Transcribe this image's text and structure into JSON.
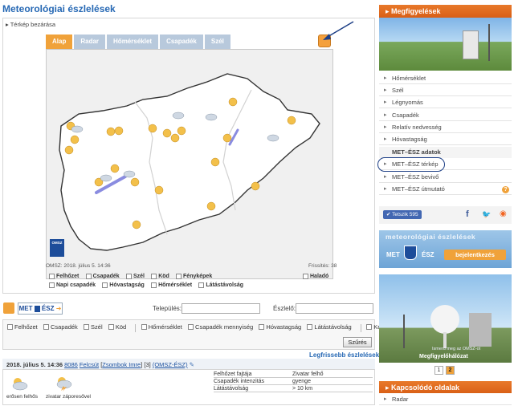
{
  "page_title": "Meteorológiai észlelések",
  "map": {
    "toggle": "Térkép bezárása",
    "tabs": [
      {
        "label": "Alap",
        "active": true
      },
      {
        "label": "Radar",
        "active": false
      },
      {
        "label": "Hőmérséklet",
        "active": false
      },
      {
        "label": "Csapadék",
        "active": false
      },
      {
        "label": "Szél",
        "active": false
      }
    ],
    "footer_left": "OMSZ: 2018. július 5. 14:36",
    "footer_right": "Frissítés: 38",
    "omsz_logo": "OMSZ",
    "layers_row1": [
      "Felhőzet",
      "Csapadék",
      "Szél",
      "Köd",
      "Fényképek"
    ],
    "layers_row2": [
      "Napi csapadék",
      "Hóvastagság",
      "Hőmérséklet",
      "Látástávolság"
    ],
    "advanced": "Haladó"
  },
  "search": {
    "logo_met": "MET",
    "logo_esz": "ÉSZ",
    "settlement_label": "Település:",
    "settlement_value": "",
    "observer_label": "Észlelő:",
    "observer_value": ""
  },
  "filters": {
    "group1": [
      "Felhőzet",
      "Csapadék",
      "Szél",
      "Köd"
    ],
    "group2": [
      "Hőmérséklet",
      "Csapadék mennyiség",
      "Hóvastagság",
      "Látástávolság"
    ],
    "group3": [
      "Kép"
    ],
    "button": "Szűrés"
  },
  "latest_title": "Legfrissebb észlelések",
  "observation": {
    "date": "2018. július 5. 14:36",
    "zip": "8086",
    "place": "Felcsút",
    "observer": "Zsombok Imre",
    "flag": "[3]",
    "source": "(OMSZ-ÉSZ)",
    "icon_labels": [
      "erősen felhős",
      "zivatar záporesővel"
    ],
    "table": [
      {
        "key": "Felhőzet fajtája",
        "value": "Zivatar felhő"
      },
      {
        "key": "Csapadék intenzitás",
        "value": "gyenge"
      },
      {
        "key": "Látástávolság",
        "value": "> 10 km"
      }
    ]
  },
  "sidebar": {
    "heading": "Megfigyelések",
    "items": [
      "Hőmérséklet",
      "Szél",
      "Légnyomás",
      "Csapadék",
      "Relatív nedvesség",
      "Hóvastagság"
    ],
    "subheading": "MET–ÉSZ adatok",
    "sub_items": [
      "MET–ÉSZ térkép",
      "MET–ÉSZ bevivő",
      "MET–ÉSZ útmutató"
    ],
    "help": "?",
    "like": "Tetszik 595",
    "banner_title": "meteorológiai észlelések",
    "banner_met": "MET",
    "banner_esz": "ÉSZ",
    "banner_button": "bejelentkezés",
    "photo_caption_small": "Ismerd meg az OMSZ-ot",
    "photo_caption": "Megfigyelőhálózat",
    "pages": [
      "1",
      "2"
    ],
    "related_heading": "Kapcsolódó oldalak",
    "related_items": [
      "Radar"
    ]
  },
  "colors": {
    "accent_orange": "#f0a23a",
    "title_blue": "#2668b4",
    "tab_inactive": "#b8c9dc"
  }
}
